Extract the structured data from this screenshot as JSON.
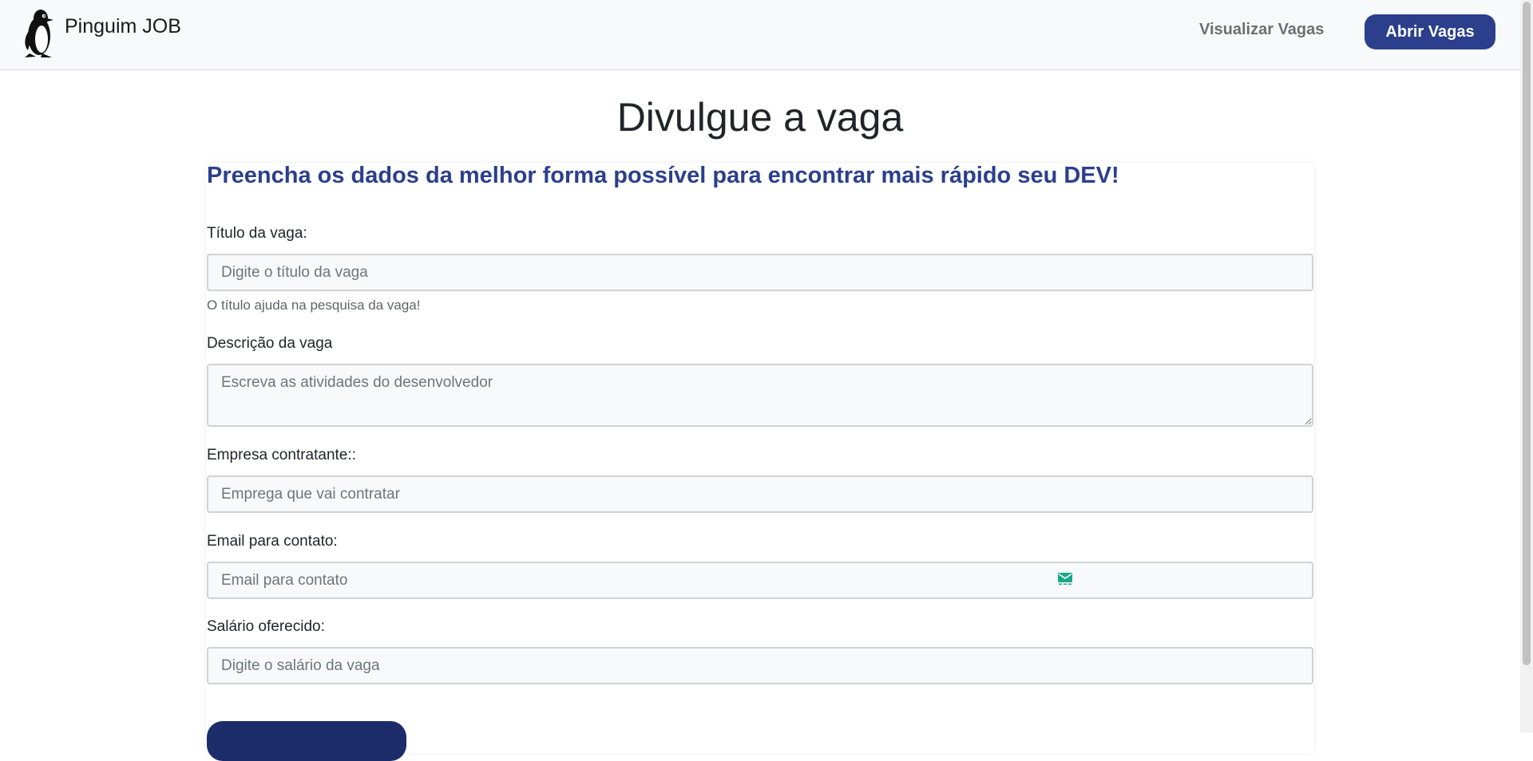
{
  "navbar": {
    "brand_name": "Pinguim JOB",
    "links": {
      "view_jobs": "Visualizar Vagas",
      "open_jobs": "Abrir Vagas"
    }
  },
  "page": {
    "title": "Divulgue a vaga"
  },
  "form": {
    "heading": "Preencha os dados da melhor forma possível para encontrar mais rápido seu DEV!",
    "title_field": {
      "label": "Título da vaga:",
      "placeholder": "Digite o título da vaga",
      "help": "O título ajuda na pesquisa da vaga!"
    },
    "description_field": {
      "label": "Descrição da vaga",
      "placeholder": "Escreva as atividades do desenvolvedor"
    },
    "company_field": {
      "label": "Empresa contratante::",
      "placeholder": "Emprega que vai contratar"
    },
    "email_field": {
      "label": "Email para contato:",
      "placeholder": "Email para contato",
      "icon": "envelope-icon"
    },
    "salary_field": {
      "label": "Salário oferecido:",
      "placeholder": "Digite o salário da vaga"
    }
  },
  "colors": {
    "brand_blue": "#2b3f8c",
    "submit_blue": "#1c2c6b",
    "navbar_bg": "#f8f9fa",
    "email_icon": "#1aa688"
  }
}
